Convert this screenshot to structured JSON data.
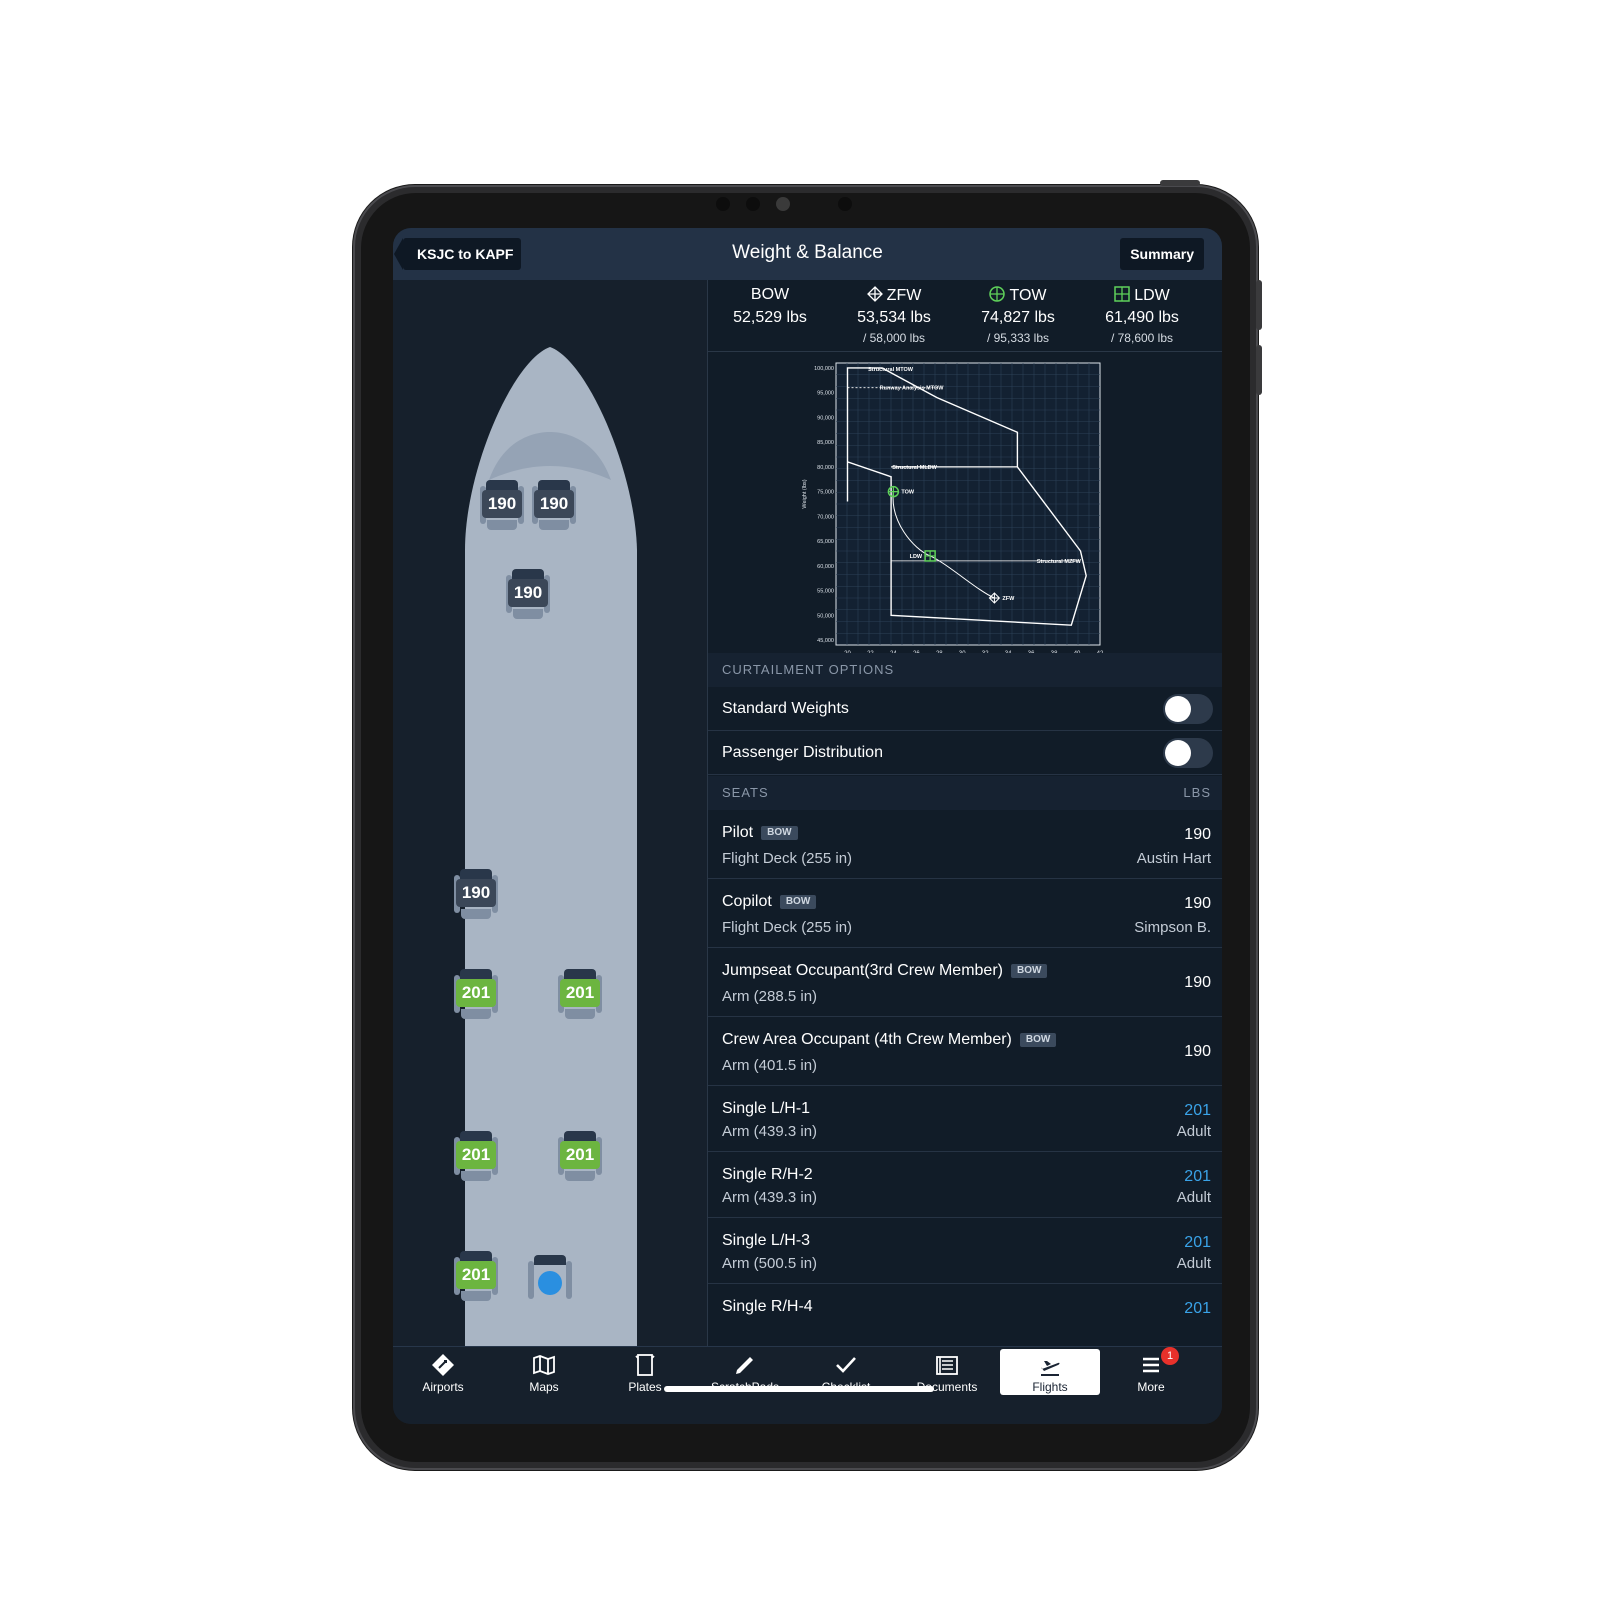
{
  "nav": {
    "back_label": "KSJC to KAPF",
    "title": "Weight & Balance",
    "summary_label": "Summary"
  },
  "weights": [
    {
      "name": "BOW",
      "value": "52,529 lbs",
      "max": "",
      "icon": "",
      "color": "#ffffff"
    },
    {
      "name": "ZFW",
      "value": "53,534 lbs",
      "max": "/ 58,000 lbs",
      "icon": "zfw-icon",
      "color": "#ffffff"
    },
    {
      "name": "TOW",
      "value": "74,827 lbs",
      "max": "/ 95,333 lbs",
      "icon": "tow-icon",
      "color": "#5fd15a"
    },
    {
      "name": "LDW",
      "value": "61,490 lbs",
      "max": "/ 78,600 lbs",
      "icon": "ldw-icon",
      "color": "#5fd15a"
    }
  ],
  "chart_data": {
    "type": "line",
    "ylabel": "Weight (lbs)",
    "x_ticks": [
      "20",
      "22",
      "24",
      "26",
      "28",
      "30",
      "32",
      "34",
      "36",
      "38",
      "40",
      "42"
    ],
    "y_ticks": [
      "100,000",
      "95,000",
      "90,000",
      "85,000",
      "80,000",
      "75,000",
      "70,000",
      "65,000",
      "60,000",
      "55,000",
      "50,000",
      "45,000"
    ],
    "xlim": [
      19,
      42
    ],
    "ylim": [
      44000,
      101000
    ],
    "grid": true,
    "labels": {
      "structural_mtow": "Structural MTOW",
      "runway_mtow": "Runway Analysis MTOW",
      "structural_mldw": "Structural MLDW",
      "structural_mzfw": "Structural MZFW",
      "tow": "TOW",
      "ldw": "LDW",
      "zfw": "ZFW"
    },
    "envelope": [
      [
        20,
        73000
      ],
      [
        20,
        100000
      ],
      [
        23,
        100000
      ],
      [
        27.8,
        94000
      ],
      [
        34.8,
        87000
      ],
      [
        34.8,
        80000
      ],
      [
        40.3,
        63000
      ],
      [
        40.8,
        58000
      ],
      [
        39.5,
        48000
      ],
      [
        23.8,
        50000
      ],
      [
        23.8,
        78000
      ],
      [
        20,
        81000
      ]
    ],
    "mldw_line": [
      [
        23.8,
        80000
      ],
      [
        34.8,
        80000
      ]
    ],
    "mzfw_line": [
      [
        23.8,
        61000
      ],
      [
        40.3,
        61000
      ]
    ],
    "runway_mtow_line": [
      [
        20,
        96000
      ],
      [
        27.8,
        96000
      ]
    ],
    "cg_path": [
      [
        24,
        75000
      ],
      [
        27.2,
        62000
      ],
      [
        32.8,
        53500
      ]
    ],
    "points": [
      {
        "name": "TOW",
        "x": 24,
        "y": 75000,
        "color": "#5fd15a"
      },
      {
        "name": "LDW",
        "x": 27.2,
        "y": 62000,
        "color": "#5fd15a"
      },
      {
        "name": "ZFW",
        "x": 32.8,
        "y": 53500,
        "color": "#ffffff"
      }
    ]
  },
  "curtailment": {
    "header": "CURTAILMENT OPTIONS",
    "options": [
      {
        "label": "Standard Weights",
        "on": false
      },
      {
        "label": "Passenger Distribution",
        "on": false
      }
    ]
  },
  "seats_header": {
    "left": "SEATS",
    "right": "LBS"
  },
  "seats": [
    {
      "name": "Pilot",
      "badge": "BOW",
      "arm": "Flight Deck (255 in)",
      "value": "190",
      "sub": "Austin Hart",
      "blue": false
    },
    {
      "name": "Copilot",
      "badge": "BOW",
      "arm": "Flight Deck (255 in)",
      "value": "190",
      "sub": "Simpson B.",
      "blue": false
    },
    {
      "name": "Jumpseat Occupant(3rd Crew Member)",
      "badge": "BOW",
      "arm": "Arm (288.5 in)",
      "value": "190",
      "sub": "",
      "blue": false
    },
    {
      "name": "Crew Area Occupant (4th Crew Member)",
      "badge": "BOW",
      "arm": "Arm (401.5 in)",
      "value": "190",
      "sub": "",
      "blue": false
    },
    {
      "name": "Single L/H-1",
      "badge": "",
      "arm": "Arm (439.3 in)",
      "value": "201",
      "sub": "Adult",
      "blue": true
    },
    {
      "name": "Single R/H-2",
      "badge": "",
      "arm": "Arm (439.3 in)",
      "value": "201",
      "sub": "Adult",
      "blue": true
    },
    {
      "name": "Single L/H-3",
      "badge": "",
      "arm": "Arm (500.5 in)",
      "value": "201",
      "sub": "Adult",
      "blue": true
    },
    {
      "name": "Single R/H-4",
      "badge": "",
      "arm": "",
      "value": "201",
      "sub": "",
      "blue": true
    }
  ],
  "cabin_seats": [
    {
      "label": "190",
      "kind": "crew"
    },
    {
      "label": "190",
      "kind": "crew"
    },
    {
      "label": "190",
      "kind": "crew"
    },
    {
      "label": "190",
      "kind": "crew"
    },
    {
      "label": "201",
      "kind": "pax"
    },
    {
      "label": "201",
      "kind": "pax"
    },
    {
      "label": "201",
      "kind": "pax"
    },
    {
      "label": "201",
      "kind": "pax"
    },
    {
      "label": "201",
      "kind": "pax"
    }
  ],
  "tabs": [
    {
      "label": "Airports",
      "icon": "airports-icon"
    },
    {
      "label": "Maps",
      "icon": "maps-icon"
    },
    {
      "label": "Plates",
      "icon": "plates-icon"
    },
    {
      "label": "ScratchPads",
      "icon": "scratchpads-icon"
    },
    {
      "label": "Checklist",
      "icon": "checklist-icon"
    },
    {
      "label": "Documents",
      "icon": "documents-icon"
    },
    {
      "label": "Flights",
      "icon": "flights-icon",
      "active": true
    },
    {
      "label": "More",
      "icon": "more-icon",
      "badge": "1"
    }
  ]
}
